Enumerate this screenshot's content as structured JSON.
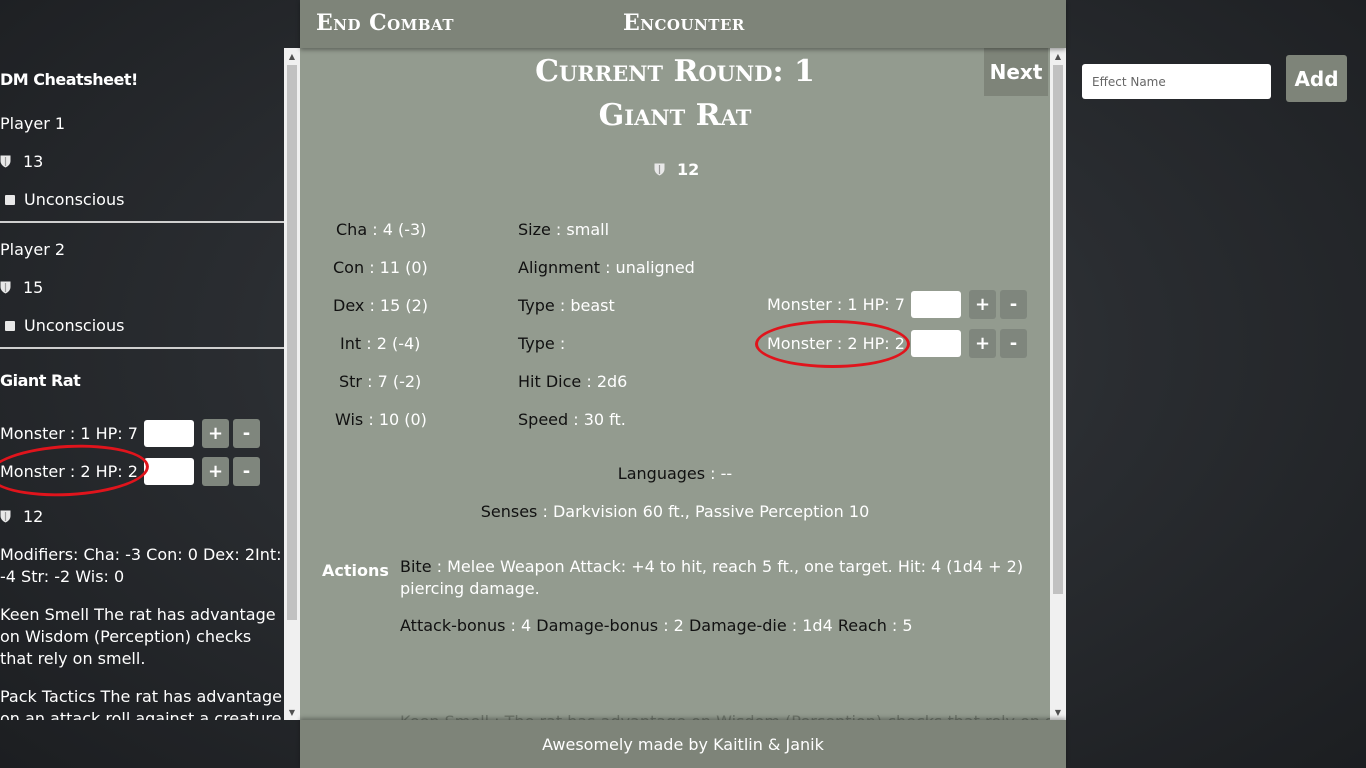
{
  "header": {
    "end_combat": "End Combat",
    "title": "Encounter"
  },
  "sidebar": {
    "title": "DM Cheatsheet!",
    "players": [
      {
        "name": "Player 1",
        "ac": "13",
        "condition": "Unconscious"
      },
      {
        "name": "Player 2",
        "ac": "15",
        "condition": "Unconscious"
      }
    ],
    "monster_group": {
      "name": "Giant Rat",
      "monsters": [
        {
          "label": "Monster : 1 HP: 7",
          "plus": "+",
          "minus": "-"
        },
        {
          "label": "Monster : 2 HP: 2",
          "plus": "+",
          "minus": "-"
        }
      ],
      "ac": "12",
      "modifiers": "Modifiers: Cha: -3 Con: 0 Dex: 2Int: -4 Str: -2 Wis: 0",
      "keen_smell": "Keen Smell The rat has advantage on Wisdom (Perception) checks that rely on smell.",
      "pack_tactics": "Pack Tactics The rat has advantage on an attack roll against a creature if at"
    }
  },
  "main": {
    "round": "Current Round: 1",
    "creature": "Giant Rat",
    "ac": "12",
    "next": "Next",
    "abilities": [
      {
        "label": "Cha",
        "value": " : 4 (-3)"
      },
      {
        "label": "Con",
        "value": " : 11 (0)"
      },
      {
        "label": "Dex",
        "value": " : 15 (2)"
      },
      {
        "label": "Int",
        "value": " : 2 (-4)"
      },
      {
        "label": "Str",
        "value": " : 7 (-2)"
      },
      {
        "label": "Wis",
        "value": " : 10 (0)"
      }
    ],
    "traits": [
      {
        "label": "Size",
        "value": " : small"
      },
      {
        "label": "Alignment",
        "value": " : unaligned"
      },
      {
        "label": "Type",
        "value": " : beast"
      },
      {
        "label": "Type",
        "value": " :"
      },
      {
        "label": "Hit Dice",
        "value": " : 2d6"
      },
      {
        "label": "Speed",
        "value": " : 30 ft."
      }
    ],
    "monsters": [
      {
        "label": "Monster : 1 HP: 7",
        "plus": "+",
        "minus": "-"
      },
      {
        "label": "Monster : 2 HP: 2",
        "plus": "+",
        "minus": "-"
      }
    ],
    "languages": {
      "label": "Languages",
      "value": " : --"
    },
    "senses": {
      "label": "Senses",
      "value": " : Darkvision 60 ft., Passive Perception 10"
    },
    "actions_label": "Actions",
    "action": {
      "name": "Bite",
      "desc": " : Melee Weapon Attack: +4 to hit, reach 5 ft., one target. Hit: 4 (1d4 + 2) piercing damage.",
      "attack_bonus_label": "Attack-bonus",
      "attack_bonus_value": " : 4 ",
      "damage_bonus_label": "Damage-bonus",
      "damage_bonus_value": " : 2 ",
      "damage_die_label": "Damage-die",
      "damage_die_value": " : 1d4 ",
      "reach_label": "Reach",
      "reach_value": " : 5"
    },
    "cut_off_text": "Keen Smell : The rat has advantage on Wisdom (Perception) checks that rely on smell."
  },
  "footer": {
    "credit": "Awesomely made by Kaitlin & Janik"
  },
  "effects": {
    "placeholder": "Effect Name",
    "add_label": "Add"
  },
  "colors": {
    "panel": "#939b8f",
    "bar": "#7e8479",
    "highlight_ring": "#e0141c"
  }
}
